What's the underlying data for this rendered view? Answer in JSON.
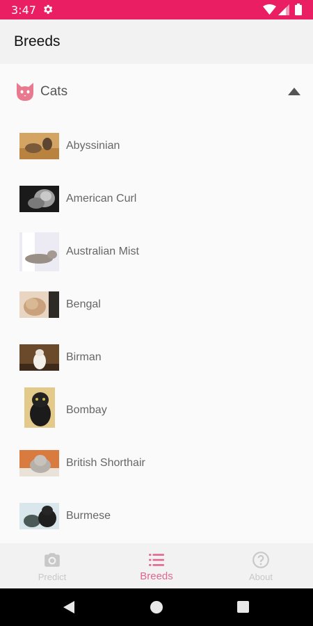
{
  "status_bar": {
    "time": "3:47",
    "icons": [
      "gear-icon",
      "wifi-icon",
      "signal-icon",
      "battery-icon"
    ]
  },
  "app_bar": {
    "title": "Breeds"
  },
  "section": {
    "title": "Cats",
    "icon": "cat-face-icon",
    "expanded": true
  },
  "breeds": [
    {
      "name": "Abyssinian"
    },
    {
      "name": "American Curl"
    },
    {
      "name": "Australian Mist"
    },
    {
      "name": "Bengal"
    },
    {
      "name": "Birman"
    },
    {
      "name": "Bombay"
    },
    {
      "name": "British Shorthair"
    },
    {
      "name": "Burmese"
    }
  ],
  "bottom_nav": {
    "items": [
      {
        "label": "Predict",
        "icon": "camera-icon",
        "active": false
      },
      {
        "label": "Breeds",
        "icon": "list-icon",
        "active": true
      },
      {
        "label": "About",
        "icon": "help-circle-icon",
        "active": false
      }
    ]
  },
  "colors": {
    "accent": "#e91e63",
    "active_nav": "#e0668e",
    "inactive_nav": "#c8c8c8"
  }
}
